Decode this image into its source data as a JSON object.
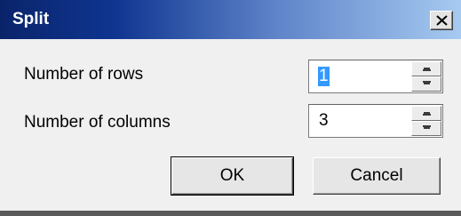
{
  "window": {
    "title": "Split",
    "close_icon": "close-icon"
  },
  "fields": {
    "rows_label": "Number of rows",
    "rows_value": "1",
    "columns_label": "Number of columns",
    "columns_value": "3"
  },
  "buttons": {
    "ok_label": "OK",
    "cancel_label": "Cancel"
  },
  "colors": {
    "titlebar_start": "#0a246a",
    "titlebar_end": "#a6caf0",
    "selection": "#3399ff"
  }
}
